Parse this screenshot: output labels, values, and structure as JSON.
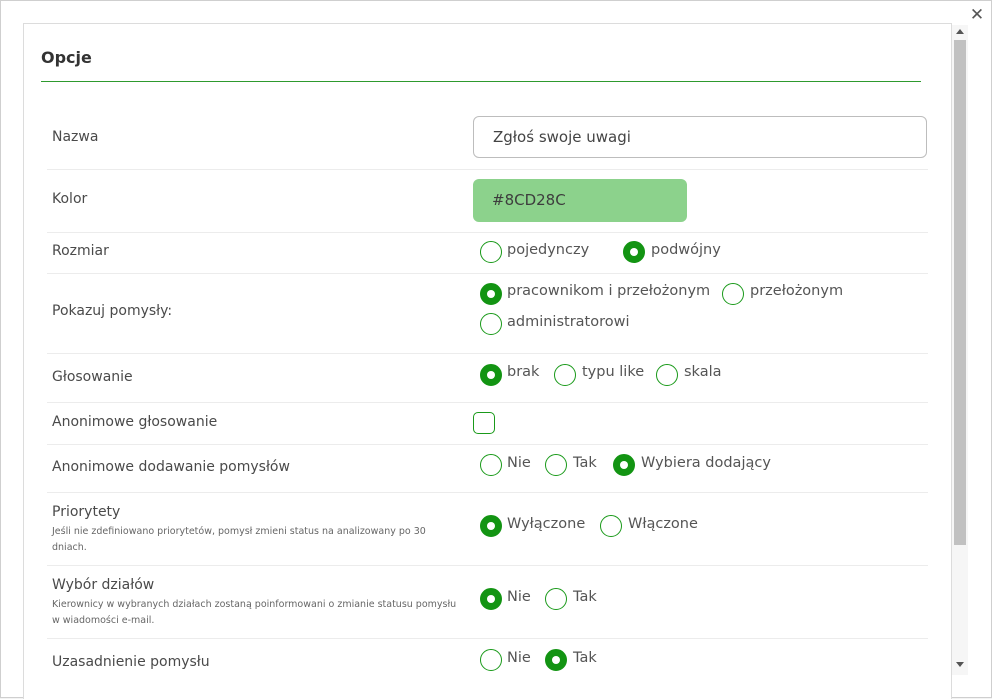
{
  "dialog": {
    "title": "Opcje"
  },
  "colors": {
    "accent": "#139413",
    "swatch": "#8CD28C"
  },
  "fields": {
    "name": {
      "label": "Nazwa",
      "value": "Zgłoś swoje uwagi"
    },
    "color": {
      "label": "Kolor",
      "value": "#8CD28C"
    },
    "size": {
      "label": "Rozmiar",
      "options": [
        "pojedynczy",
        "podwójny"
      ],
      "selected": "podwójny"
    },
    "show_ideas": {
      "label": "Pokazuj pomysły:",
      "options": [
        "pracownikom i przełożonym",
        "przełożonym",
        "administratorowi"
      ],
      "selected": "pracownikom i przełożonym"
    },
    "voting": {
      "label": "Głosowanie",
      "options": [
        "brak",
        "typu like",
        "skala"
      ],
      "selected": "brak"
    },
    "anon_voting": {
      "label": "Anonimowe głosowanie",
      "checked": false
    },
    "anon_adding": {
      "label": "Anonimowe dodawanie pomysłów",
      "options": [
        "Nie",
        "Tak",
        "Wybiera dodający"
      ],
      "selected": "Wybiera dodający"
    },
    "priorities": {
      "label": "Priorytety",
      "hint": "Jeśli nie zdefiniowano priorytetów, pomysł zmieni status na analizowany po 30 dniach.",
      "options": [
        "Wyłączone",
        "Włączone"
      ],
      "selected": "Wyłączone"
    },
    "departments": {
      "label": "Wybór działów",
      "hint": "Kierownicy w wybranych działach zostaną poinformowani o zmianie statusu pomysłu w wiadomości e-mail.",
      "options": [
        "Nie",
        "Tak"
      ],
      "selected": "Nie"
    },
    "justification": {
      "label": "Uzasadnienie pomysłu",
      "options": [
        "Nie",
        "Tak"
      ],
      "selected": "Tak"
    }
  }
}
